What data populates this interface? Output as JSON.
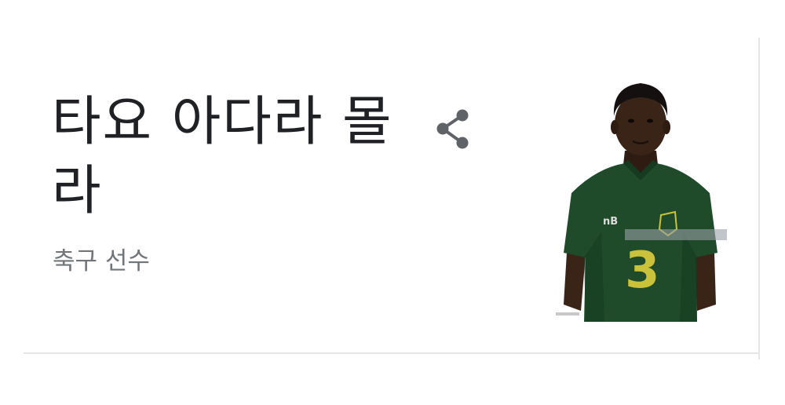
{
  "knowledge_panel": {
    "name": "타요 아다라 몰라",
    "description": "축구 선수"
  },
  "share": {
    "icon": "share-icon"
  },
  "photo": {
    "shirt_number": "3",
    "colors": {
      "shirt": "#1f4b2a",
      "shirt_shade": "#163a20",
      "number": "#c9c23a",
      "skin": "#3a2418",
      "hair": "#151010"
    }
  }
}
